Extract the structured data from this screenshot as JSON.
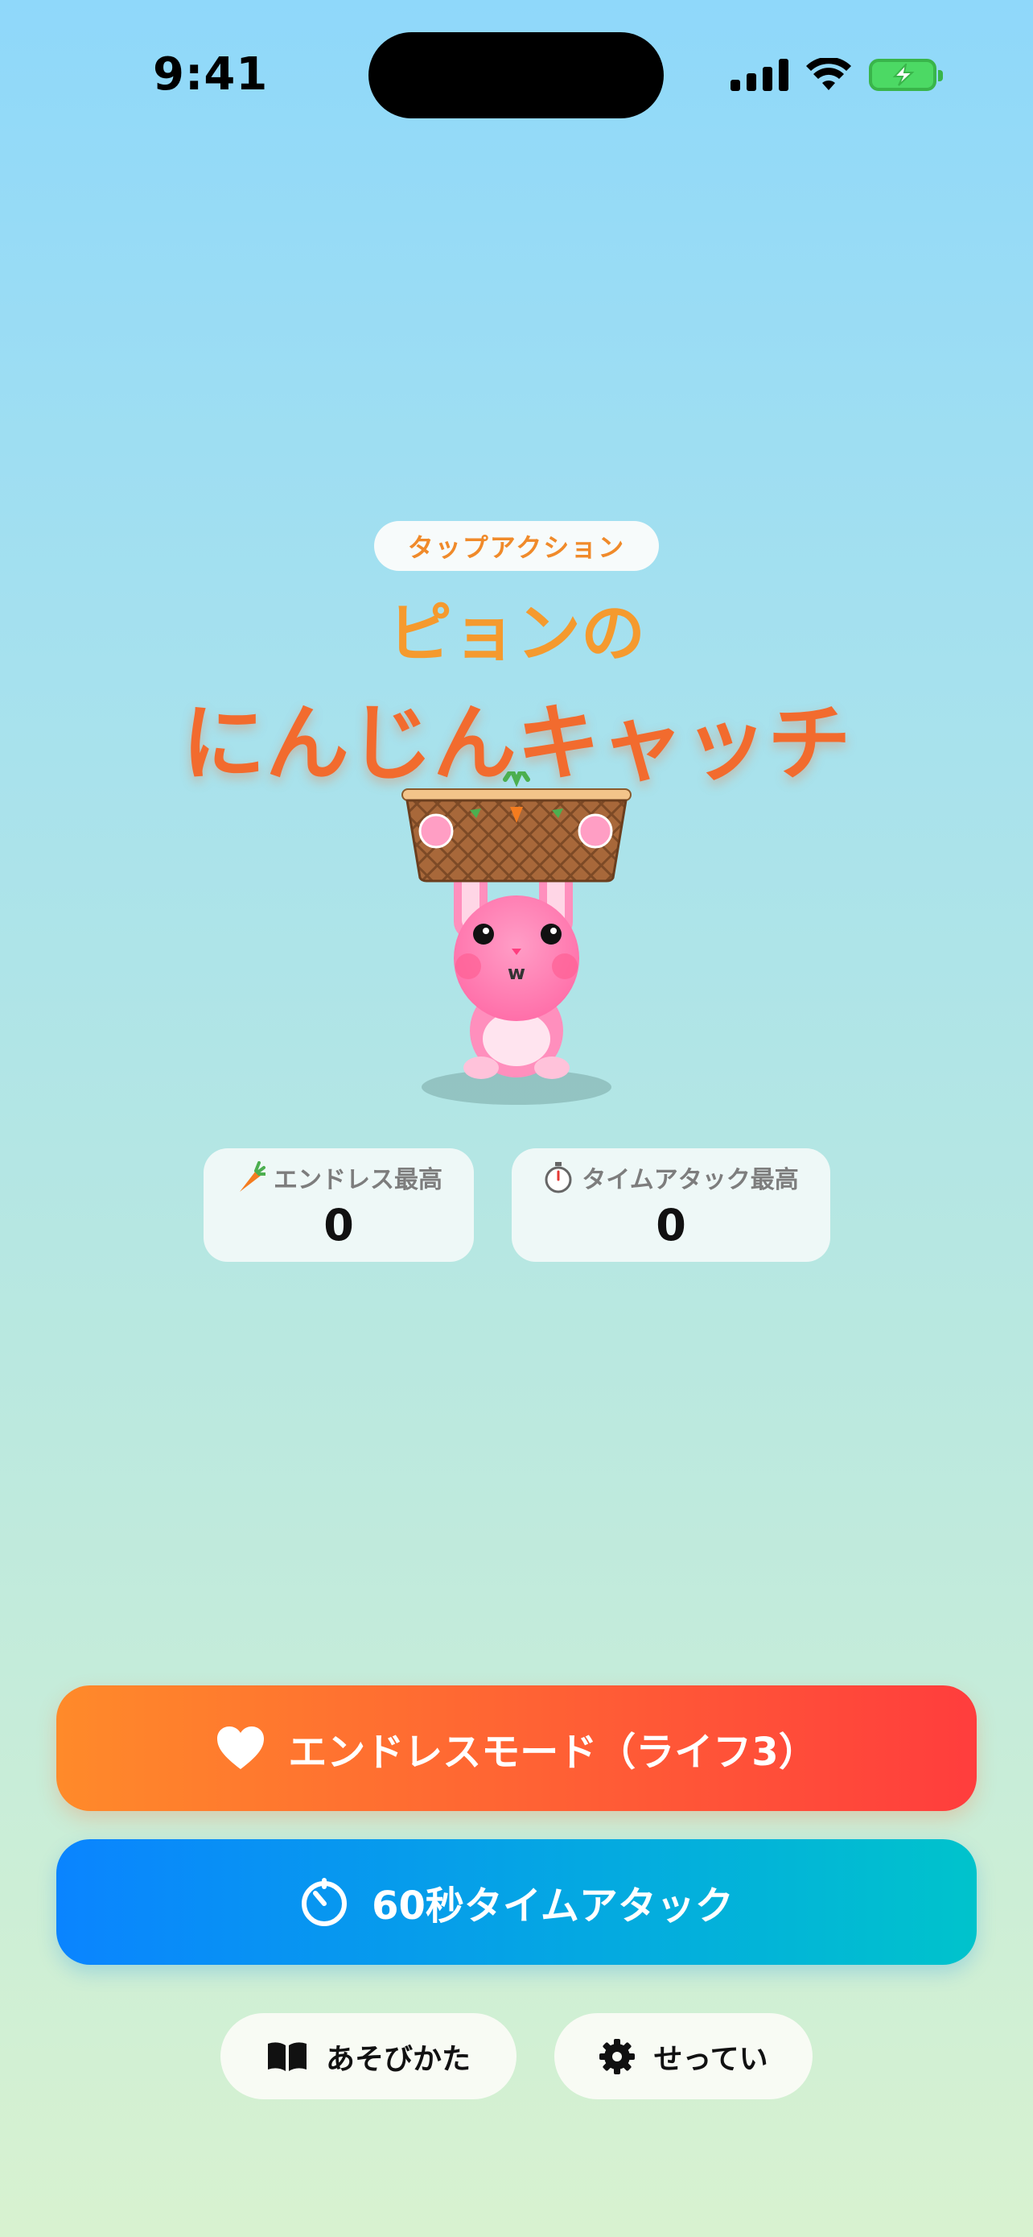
{
  "status_bar": {
    "time": "9:41"
  },
  "header": {
    "badge": "タップアクション",
    "title_line1": "ピョンの",
    "title_line2": "にんじんキャッチ"
  },
  "scores": [
    {
      "icon": "carrot-icon",
      "label": "エンドレス最高",
      "value": "0"
    },
    {
      "icon": "stopwatch-icon",
      "label": "タイムアタック最高",
      "value": "0"
    }
  ],
  "buttons": {
    "endless": "エンドレスモード（ライフ3）",
    "time_attack": "60秒タイムアタック",
    "how_to_play": "あそびかた",
    "settings": "せってい"
  },
  "colors": {
    "endless_gradient": [
      "#ff8a2a",
      "#ff3d3d"
    ],
    "time_gradient": [
      "#0a84ff",
      "#00c3cc"
    ],
    "title": "#f26b2e"
  }
}
